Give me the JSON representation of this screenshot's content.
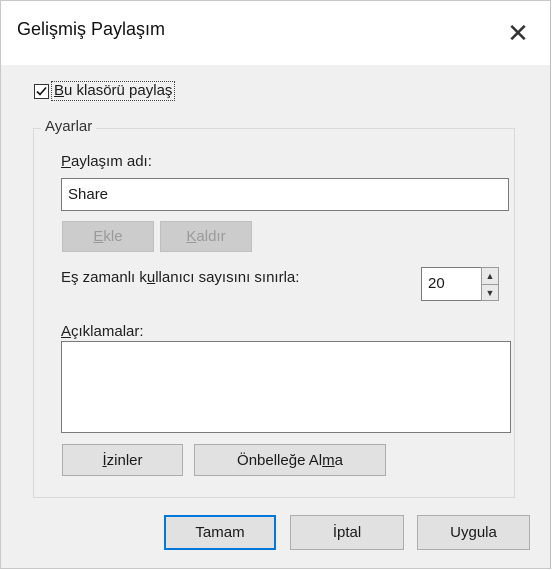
{
  "window": {
    "title": "Gelişmiş Paylaşım",
    "close_glyph": "✕"
  },
  "share_checkbox": {
    "label_u": "B",
    "label_rest": "u klasörü paylaş",
    "checked": true
  },
  "settings": {
    "group_title": "Ayarlar",
    "share_name_label_u": "P",
    "share_name_label_rest": "aylaşım adı:",
    "share_name_value": "Share",
    "add_label_u": "E",
    "add_label_rest": "kle",
    "remove_label_u": "K",
    "remove_label_rest": "aldır",
    "limit_label_pre": "Eş zamanlı k",
    "limit_label_u": "u",
    "limit_label_post": "llanıcı sayısını sınırla:",
    "limit_value": "20",
    "comments_label_u": "A",
    "comments_label_rest": "çıklamalar:",
    "comments_value": "",
    "permissions_label_u": "İ",
    "permissions_label_rest": "zinler",
    "caching_label_pre": "Önbelleğe Al",
    "caching_label_u": "m",
    "caching_label_post": "a"
  },
  "footer": {
    "ok_label": "Tamam",
    "cancel_label": "İptal",
    "apply_label": "Uygula"
  },
  "colors": {
    "accent": "#0078d7",
    "dialog_bg": "#f0f0f0",
    "button_bg": "#e1e1e1"
  },
  "icons": {
    "check": "checkmark-icon",
    "up": "spin-up-icon",
    "down": "spin-down-icon",
    "close": "close-icon"
  }
}
